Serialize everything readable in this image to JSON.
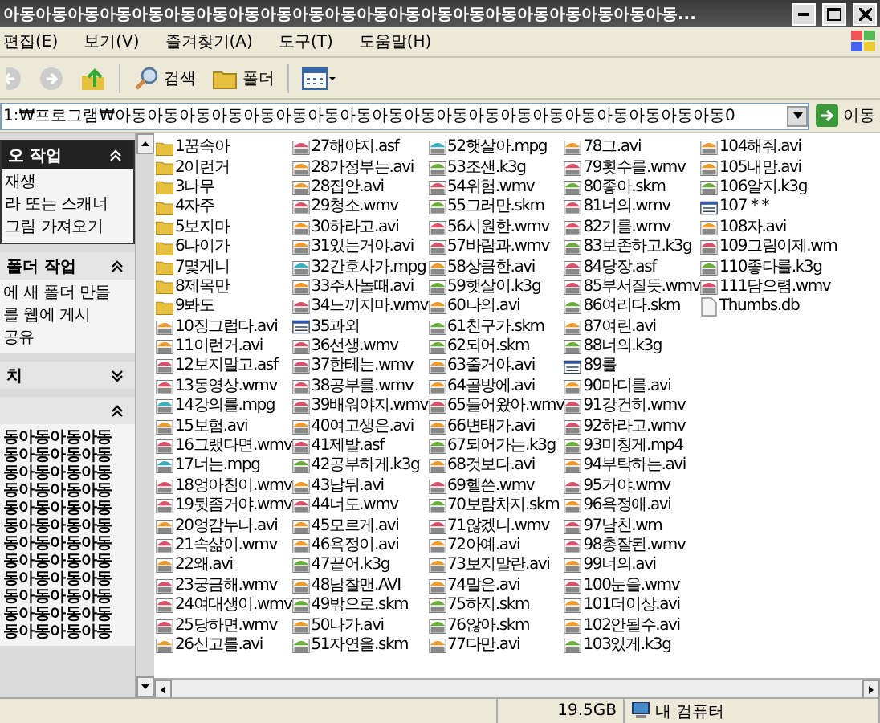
{
  "window": {
    "title": "아동아동아동아동아동아동아동아동아동아동아동아동아동아동아동아동아동아동아동아동아동..."
  },
  "menu": [
    "편집(E)",
    "보기(V)",
    "즐겨찾기(A)",
    "도구(T)",
    "도움말(H)"
  ],
  "toolbar": {
    "search": "검색",
    "folders": "폴더"
  },
  "address": {
    "value": "1:₩프로그램₩아동아동아동아동아동아동아동아동아동아동아동아동아동아동아동아동아동아동아동0",
    "go": "이동"
  },
  "task_pane": [
    {
      "title": "오 작업",
      "kind": "special",
      "expanded": true,
      "items": [
        "재생",
        "라 또는 스캐너",
        "그림 가져오기"
      ]
    },
    {
      "title": "폴더 작업",
      "kind": "normal",
      "expanded": true,
      "items": [
        "에 새 폴더 만들",
        "를 웹에 게시",
        "공유"
      ]
    },
    {
      "title": "치",
      "kind": "normal",
      "expanded": false
    },
    {
      "kind": "details",
      "expanded": true,
      "items": [
        "동아동아동아동",
        "동아동아동아동",
        "동아동아동아동",
        "동아동아동아동",
        "동아동아동아동",
        "동아동아동아동",
        "동아동아동아동",
        "동아동아동아동",
        "동아동아동아동",
        "동아동아동아동",
        "동아동아동아동",
        "동아동아동아동"
      ]
    }
  ],
  "files": [
    {
      "name": "1꿈속아",
      "kind": "folder"
    },
    {
      "name": "2이런거",
      "kind": "folder"
    },
    {
      "name": "3나무",
      "kind": "folder"
    },
    {
      "name": "4자주",
      "kind": "folder"
    },
    {
      "name": "5보지마",
      "kind": "folder"
    },
    {
      "name": "6나이가",
      "kind": "folder"
    },
    {
      "name": "7몇게니",
      "kind": "folder"
    },
    {
      "name": "8제목만",
      "kind": "folder"
    },
    {
      "name": "9봐도",
      "kind": "folder"
    },
    {
      "name": "10징그럽다.avi",
      "kind": "avi"
    },
    {
      "name": "11이런거.avi",
      "kind": "avi"
    },
    {
      "name": "12보지말고.asf",
      "kind": "wmv"
    },
    {
      "name": "13동영상.wmv",
      "kind": "wmv"
    },
    {
      "name": "14강의를.mpg",
      "kind": "mpg"
    },
    {
      "name": "15보험.avi",
      "kind": "avi"
    },
    {
      "name": "16그랬다면.wmv",
      "kind": "wmv"
    },
    {
      "name": "17너는.mpg",
      "kind": "mpg"
    },
    {
      "name": "18엉아침이.wmv",
      "kind": "wmv"
    },
    {
      "name": "19뒷좀거야.wmv",
      "kind": "wmv"
    },
    {
      "name": "20엉감누나.avi",
      "kind": "avi"
    },
    {
      "name": "21속삶이.wmv",
      "kind": "wmv"
    },
    {
      "name": "22왜.avi",
      "kind": "avi"
    },
    {
      "name": "23궁금해.wmv",
      "kind": "wmv"
    },
    {
      "name": "24여대생이.wmv",
      "kind": "wmv"
    },
    {
      "name": "25당하면.wmv",
      "kind": "wmv"
    },
    {
      "name": "26신고를.avi",
      "kind": "avi"
    },
    {
      "name": "27해야지.asf",
      "kind": "wmv"
    },
    {
      "name": "28가정부는.avi",
      "kind": "avi"
    },
    {
      "name": "28집안.avi",
      "kind": "avi"
    },
    {
      "name": "29청소.wmv",
      "kind": "wmv"
    },
    {
      "name": "30하라고.avi",
      "kind": "avi"
    },
    {
      "name": "31있는거야.avi",
      "kind": "avi"
    },
    {
      "name": "32간호사가.mpg",
      "kind": "mpg"
    },
    {
      "name": "33주사놀때.avi",
      "kind": "avi"
    },
    {
      "name": "34느끼지마.wmv",
      "kind": "wmv"
    },
    {
      "name": "35과외",
      "kind": "other"
    },
    {
      "name": "36선생.wmv",
      "kind": "wmv"
    },
    {
      "name": "37한테는.wmv",
      "kind": "wmv"
    },
    {
      "name": "38공부를.wmv",
      "kind": "wmv"
    },
    {
      "name": "39배워야지.wmv",
      "kind": "wmv"
    },
    {
      "name": "40여고생은.avi",
      "kind": "avi"
    },
    {
      "name": "41제발.asf",
      "kind": "wmv"
    },
    {
      "name": "42공부하게.k3g",
      "kind": "k3g"
    },
    {
      "name": "43납뒤.avi",
      "kind": "avi"
    },
    {
      "name": "44너도.wmv",
      "kind": "wmv"
    },
    {
      "name": "45모르게.avi",
      "kind": "avi"
    },
    {
      "name": "46욕정이.avi",
      "kind": "avi"
    },
    {
      "name": "47끝어.k3g",
      "kind": "k3g"
    },
    {
      "name": "48남찰맨.AVI",
      "kind": "avi"
    },
    {
      "name": "49밖으로.skm",
      "kind": "k3g"
    },
    {
      "name": "50나가.avi",
      "kind": "avi"
    },
    {
      "name": "51자연을.skm",
      "kind": "k3g"
    },
    {
      "name": "52햇살아.mpg",
      "kind": "mpg"
    },
    {
      "name": "53조샌.k3g",
      "kind": "k3g"
    },
    {
      "name": "54위험.wmv",
      "kind": "wmv"
    },
    {
      "name": "55그러만.skm",
      "kind": "k3g"
    },
    {
      "name": "56시원한.wmv",
      "kind": "wmv"
    },
    {
      "name": "57바람과.wmv",
      "kind": "wmv"
    },
    {
      "name": "58상큼한.avi",
      "kind": "avi"
    },
    {
      "name": "59햇살이.k3g",
      "kind": "k3g"
    },
    {
      "name": "60나의.avi",
      "kind": "avi"
    },
    {
      "name": "61친구가.skm",
      "kind": "k3g"
    },
    {
      "name": "62되어.skm",
      "kind": "k3g"
    },
    {
      "name": "63줄거야.avi",
      "kind": "avi"
    },
    {
      "name": "64골방에.avi",
      "kind": "avi"
    },
    {
      "name": "65들어왔아.wmv",
      "kind": "wmv"
    },
    {
      "name": "66변태가.avi",
      "kind": "avi"
    },
    {
      "name": "67되어가는.k3g",
      "kind": "k3g"
    },
    {
      "name": "68것보다.avi",
      "kind": "avi"
    },
    {
      "name": "69헬쓴.wmv",
      "kind": "wmv"
    },
    {
      "name": "70보람차지.skm",
      "kind": "k3g"
    },
    {
      "name": "71않겠니.wmv",
      "kind": "wmv"
    },
    {
      "name": "72아예.avi",
      "kind": "avi"
    },
    {
      "name": "73보지말란.avi",
      "kind": "avi"
    },
    {
      "name": "74말은.avi",
      "kind": "avi"
    },
    {
      "name": "75하지.skm",
      "kind": "k3g"
    },
    {
      "name": "76않아.skm",
      "kind": "k3g"
    },
    {
      "name": "77다만.avi",
      "kind": "avi"
    },
    {
      "name": "78그.avi",
      "kind": "avi"
    },
    {
      "name": "79횟수를.wmv",
      "kind": "wmv"
    },
    {
      "name": "80좋아.skm",
      "kind": "k3g"
    },
    {
      "name": "81너의.wmv",
      "kind": "wmv"
    },
    {
      "name": "82기를.wmv",
      "kind": "wmv"
    },
    {
      "name": "83보존하고.k3g",
      "kind": "k3g"
    },
    {
      "name": "84당장.asf",
      "kind": "wmv"
    },
    {
      "name": "85부서질듯.wmv",
      "kind": "wmv"
    },
    {
      "name": "86여리다.skm",
      "kind": "k3g"
    },
    {
      "name": "87여린.avi",
      "kind": "avi"
    },
    {
      "name": "88너의.k3g",
      "kind": "k3g"
    },
    {
      "name": "89를",
      "kind": "other"
    },
    {
      "name": "90마디를.avi",
      "kind": "avi"
    },
    {
      "name": "91강건히.wmv",
      "kind": "wmv"
    },
    {
      "name": "92하라고.wmv",
      "kind": "wmv"
    },
    {
      "name": "93미칭게.mp4",
      "kind": "k3g"
    },
    {
      "name": "94부탁하는.avi",
      "kind": "avi"
    },
    {
      "name": "95거야.wmv",
      "kind": "wmv"
    },
    {
      "name": "96욕정애.avi",
      "kind": "avi"
    },
    {
      "name": "97남친.wm",
      "kind": "wmv"
    },
    {
      "name": "98총잘된.wmv",
      "kind": "wmv"
    },
    {
      "name": "99너의.avi",
      "kind": "avi"
    },
    {
      "name": "100눈을.wmv",
      "kind": "wmv"
    },
    {
      "name": "101더이상.avi",
      "kind": "avi"
    },
    {
      "name": "102안될수.avi",
      "kind": "avi"
    },
    {
      "name": "103있게.k3g",
      "kind": "k3g"
    },
    {
      "name": "104해줘.avi",
      "kind": "avi"
    },
    {
      "name": "105내맘.avi",
      "kind": "avi"
    },
    {
      "name": "106알지.k3g",
      "kind": "k3g"
    },
    {
      "name": "107 * *",
      "kind": "other"
    },
    {
      "name": "108자.avi",
      "kind": "avi"
    },
    {
      "name": "109그림이제.wm",
      "kind": "wmv"
    },
    {
      "name": "110좋다를.k3g",
      "kind": "k3g"
    },
    {
      "name": "111담으렴.wmv",
      "kind": "wmv"
    },
    {
      "name": "Thumbs.db",
      "kind": "db"
    }
  ],
  "status_bar": {
    "size": "19.5GB",
    "zone": "내 컴퓨터"
  }
}
